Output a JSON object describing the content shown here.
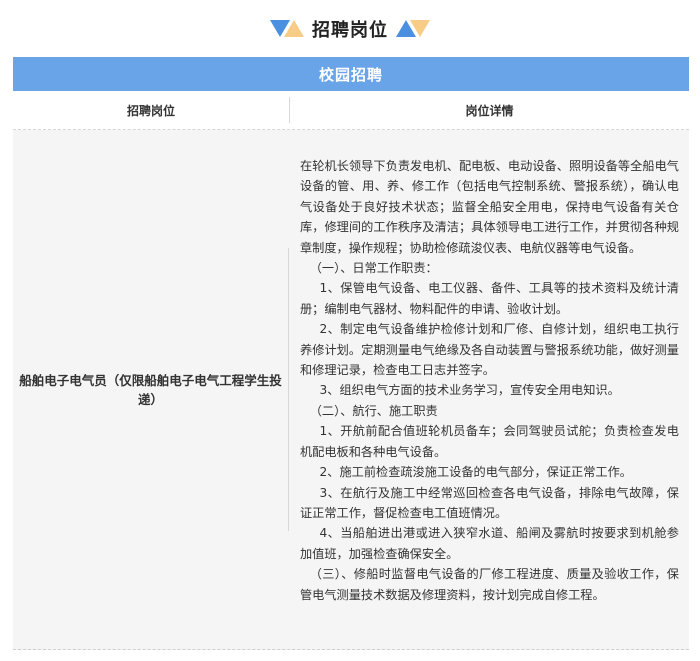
{
  "section": {
    "title": "招聘岗位",
    "accent_blue": "#4a8fe0",
    "accent_yellow": "#f5c980"
  },
  "table": {
    "banner": "校园招聘",
    "banner_color": "#6aa4e8",
    "col_position": "招聘岗位",
    "col_details": "岗位详情",
    "rows": [
      {
        "position": "船舶电子电气员（仅限船舶电子电气工程学生投递）",
        "details": {
          "intro": "在轮机长领导下负责发电机、配电板、电动设备、照明设备等全船电气设备的管、用、养、修工作（包括电气控制系统、警报系统），确认电气设备处于良好技术状态；监督全船安全用电，保持电气设备有关仓库，修理间的工作秩序及清洁；具体领导电工进行工作，并贯彻各种规章制度，操作规程；协助检修疏浚仪表、电航仪器等电气设备。",
          "daily_heading": "（一）、日常工作职责：",
          "daily_1": "1、保管电气设备、电工仪器、备件、工具等的技术资料及统计清册；编制电气器材、物料配件的申请、验收计划。",
          "daily_2": "2、制定电气设备维护检修计划和厂修、自修计划，组织电工执行养修计划。定期测量电气绝缘及各自动装置与警报系统功能，做好测量和修理记录，检查电工日志并签字。",
          "daily_3": "3、组织电气方面的技术业务学习，宣传安全用电知识。",
          "voyage_heading": "（二）、航行、施工职责",
          "voyage_1": "1、开航前配合值班轮机员备车；会同驾驶员试舵；负责检查发电机配电板和各种电气设备。",
          "voyage_2": "2、施工前检查疏浚施工设备的电气部分，保证正常工作。",
          "voyage_3": "3、在航行及施工中经常巡回检查各电气设备，排除电气故障，保证正常工作，督促检查电工值班情况。",
          "voyage_4": "4、当船舶进出港或进入狭窄水道、船闸及雾航时按要求到机舱参加值班，加强检查确保安全。",
          "repair": "（三）、修船时监督电气设备的厂修工程进度、质量及验收工作，保管电气测量技术数据及修理资料，按计划完成自修工程。"
        }
      }
    ]
  }
}
